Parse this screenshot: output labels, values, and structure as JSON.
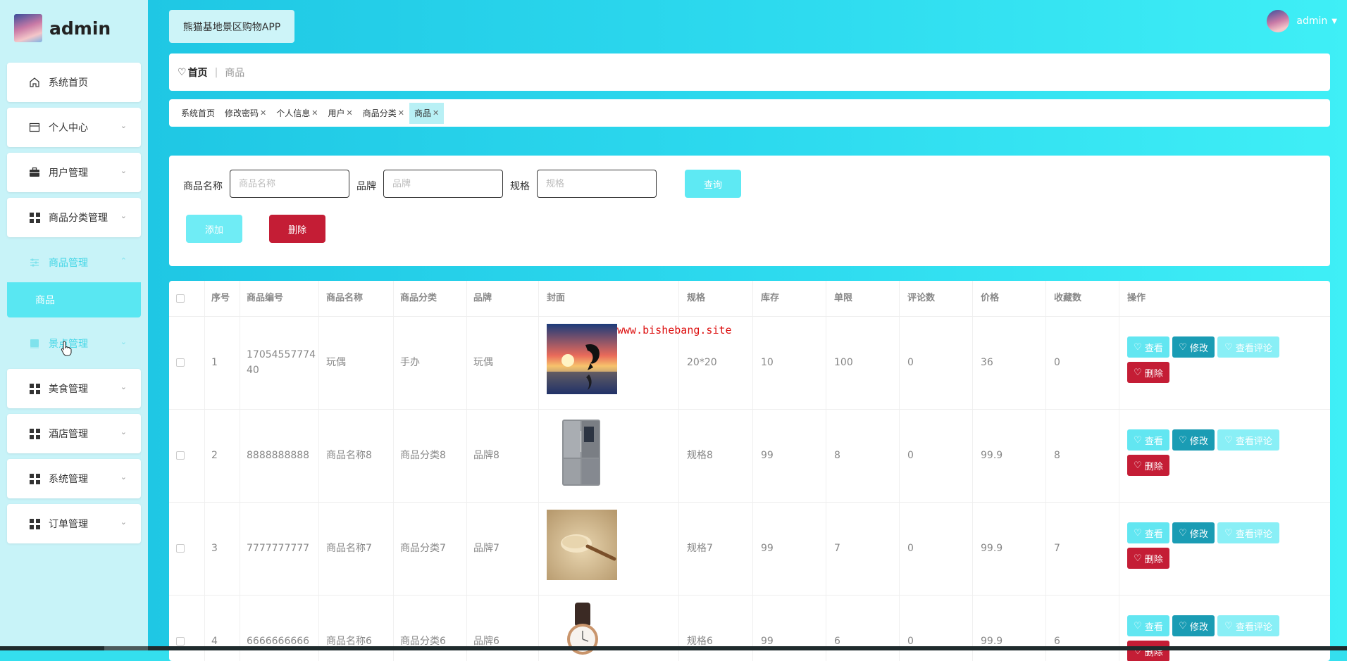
{
  "sidebar": {
    "title": "admin",
    "items": [
      {
        "label": "系统首页",
        "icon": "home-icon",
        "has_arrow": false
      },
      {
        "label": "个人中心",
        "icon": "calendar-icon",
        "has_arrow": true
      },
      {
        "label": "用户管理",
        "icon": "briefcase-icon",
        "has_arrow": true
      },
      {
        "label": "商品分类管理",
        "icon": "grid-icon",
        "has_arrow": true
      },
      {
        "label": "商品管理",
        "icon": "sliders-icon",
        "has_arrow": true,
        "active": true
      },
      {
        "label": "景点管理",
        "icon": "book-icon",
        "has_arrow": true
      },
      {
        "label": "美食管理",
        "icon": "grid-icon",
        "has_arrow": true
      },
      {
        "label": "酒店管理",
        "icon": "grid-icon",
        "has_arrow": true
      },
      {
        "label": "系统管理",
        "icon": "grid-icon",
        "has_arrow": true
      },
      {
        "label": "订单管理",
        "icon": "grid-icon",
        "has_arrow": true
      }
    ],
    "submenu_label": "商品"
  },
  "header": {
    "app_title": "熊猫基地景区购物APP",
    "user_name": "admin"
  },
  "breadcrumb": {
    "home": "首页",
    "separator": "|",
    "current": "商品"
  },
  "tags": [
    {
      "label": "系统首页",
      "closable": false
    },
    {
      "label": "修改密码",
      "closable": true
    },
    {
      "label": "个人信息",
      "closable": true
    },
    {
      "label": "用户",
      "closable": true
    },
    {
      "label": "商品分类",
      "closable": true
    },
    {
      "label": "商品",
      "closable": true,
      "active": true
    }
  ],
  "search": {
    "name_label": "商品名称",
    "name_placeholder": "商品名称",
    "brand_label": "品牌",
    "brand_placeholder": "品牌",
    "spec_label": "规格",
    "spec_placeholder": "规格",
    "query_button": "查询",
    "add_button": "添加",
    "delete_button": "删除"
  },
  "table": {
    "headers": [
      "序号",
      "商品编号",
      "商品名称",
      "商品分类",
      "品牌",
      "封面",
      "规格",
      "库存",
      "单限",
      "评论数",
      "价格",
      "收藏数",
      "操作"
    ],
    "rows": [
      {
        "index": "1",
        "code": "1705455777440",
        "name": "玩偶",
        "category": "手办",
        "brand": "玩偶",
        "cover": "dolphin-sunset-image",
        "spec": "20*20",
        "stock": "10",
        "limit": "100",
        "comments": "0",
        "price": "36",
        "favorites": "0"
      },
      {
        "index": "2",
        "code": "8888888888",
        "name": "商品名称8",
        "category": "商品分类8",
        "brand": "品牌8",
        "cover": "refrigerator-image",
        "spec": "规格8",
        "stock": "99",
        "limit": "8",
        "comments": "0",
        "price": "99.9",
        "favorites": "8"
      },
      {
        "index": "3",
        "code": "7777777777",
        "name": "商品名称7",
        "category": "商品分类7",
        "brand": "品牌7",
        "cover": "rice-spoon-image",
        "spec": "规格7",
        "stock": "99",
        "limit": "7",
        "comments": "0",
        "price": "99.9",
        "favorites": "7"
      },
      {
        "index": "4",
        "code": "6666666666",
        "name": "商品名称6",
        "category": "商品分类6",
        "brand": "品牌6",
        "cover": "watch-image",
        "spec": "规格6",
        "stock": "99",
        "limit": "6",
        "comments": "0",
        "price": "99.9",
        "favorites": "6"
      }
    ],
    "actions": {
      "view": "查看",
      "edit": "修改",
      "comments": "查看评论",
      "delete": "删除"
    }
  },
  "watermark": "www.bishebang.site",
  "colors": {
    "accent": "#34dfee",
    "danger": "#c41d35",
    "edit": "#1a9cb4"
  }
}
